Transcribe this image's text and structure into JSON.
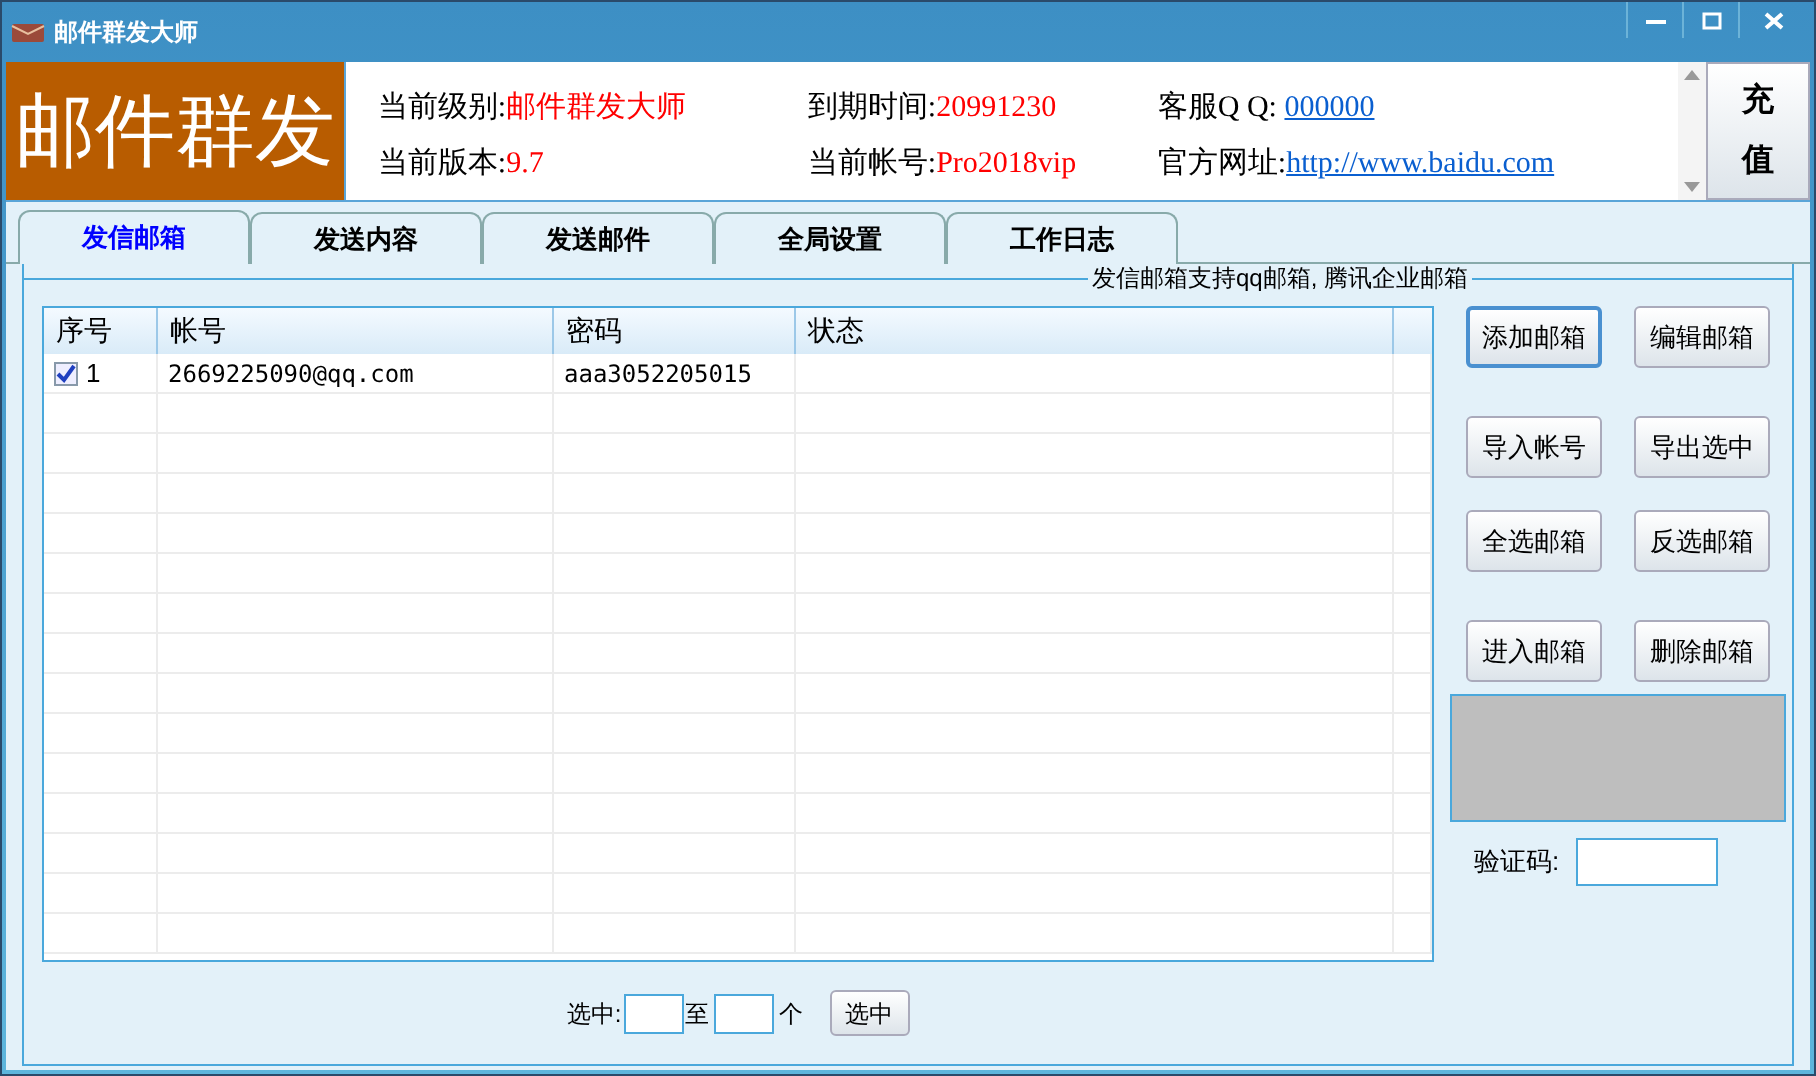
{
  "window": {
    "title": "邮件群发大师"
  },
  "header": {
    "logo": "邮件群发",
    "info": [
      {
        "label": "当前级别:",
        "value": "邮件群发大师",
        "kind": "text"
      },
      {
        "label": "当前版本:",
        "value": "9.7",
        "kind": "text"
      },
      {
        "label": "到期时间:",
        "value": "20991230",
        "kind": "text"
      },
      {
        "label": "当前帐号:",
        "value": "Pro2018vip",
        "kind": "text"
      },
      {
        "label": "客服Q Q: ",
        "value": "000000",
        "kind": "link"
      },
      {
        "label": "官方网址:",
        "value": "http://www.baidu.com",
        "kind": "link"
      }
    ],
    "recharge": "充值"
  },
  "tabs": [
    {
      "label": "发信邮箱",
      "selected": true
    },
    {
      "label": "发送内容",
      "selected": false
    },
    {
      "label": "发送邮件",
      "selected": false
    },
    {
      "label": "全局设置",
      "selected": false
    },
    {
      "label": "工作日志",
      "selected": false
    }
  ],
  "group_title": "发信邮箱支持qq邮箱, 腾讯企业邮箱",
  "table": {
    "columns": [
      "序号",
      "帐号",
      "密码",
      "状态"
    ],
    "rows": [
      {
        "checked": true,
        "cells": [
          "1",
          "2669225090@qq.com",
          "aaa3052205015",
          ""
        ]
      }
    ]
  },
  "buttons": [
    {
      "label": "添加邮箱",
      "selected": true
    },
    {
      "label": "编辑邮箱",
      "selected": false
    },
    {
      "label": "导入帐号",
      "selected": false
    },
    {
      "label": "导出选中",
      "selected": false
    },
    {
      "label": "全选邮箱",
      "selected": false
    },
    {
      "label": "反选邮箱",
      "selected": false
    },
    {
      "label": "进入邮箱",
      "selected": false
    },
    {
      "label": "删除邮箱",
      "selected": false
    }
  ],
  "captcha": {
    "label": "验证码:"
  },
  "range": {
    "label": "选中:",
    "between": "至",
    "unit": "个",
    "button": "选中"
  }
}
